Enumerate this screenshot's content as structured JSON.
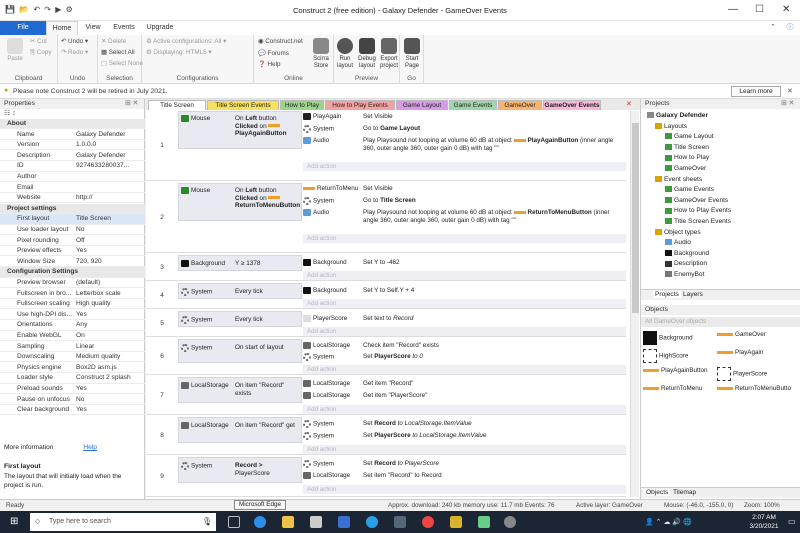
{
  "window": {
    "title": "Construct 2  (free edition) - Galaxy Defender - GameOver Events",
    "minimize": "—",
    "maximize": "☐",
    "close": "✕"
  },
  "menu": {
    "file": "File",
    "home": "Home",
    "view": "View",
    "events": "Events",
    "upgrade": "Upgrade"
  },
  "ribbon": {
    "cut": "Cut",
    "copy": "Copy",
    "paste": "Paste",
    "undo": "Undo",
    "redo": "Redo",
    "delete": "Delete",
    "select_all": "Select All",
    "select_none": "Select None",
    "active_config": "Active configurations: All",
    "displaying": "Displaying: HTML5",
    "construct_net": "Construct.net",
    "forums": "Forums",
    "help": "Help",
    "scirra_store": "Scirra Store",
    "run_layout": "Run layout",
    "debug_layout": "Debug layout",
    "export_project": "Export project",
    "start_page": "Start Page",
    "groups": {
      "clipboard": "Clipboard",
      "undo": "Undo",
      "selection": "Selection",
      "configurations": "Configurations",
      "online": "Online",
      "preview": "Preview",
      "go": "Go"
    }
  },
  "notice": {
    "text": "Please note Construct 2 will be retired in July 2021.",
    "learn_more": "Learn more"
  },
  "properties": {
    "header": "Properties",
    "rows": [
      {
        "k": "About",
        "v": "",
        "sec": true
      },
      {
        "k": "Name",
        "v": "Galaxy Defender"
      },
      {
        "k": "Version",
        "v": "1.0.0.0"
      },
      {
        "k": "Description",
        "v": "Galaxy Defender"
      },
      {
        "k": "ID",
        "v": "9274633280037..."
      },
      {
        "k": "Author",
        "v": ""
      },
      {
        "k": "Email",
        "v": ""
      },
      {
        "k": "Website",
        "v": "http://"
      },
      {
        "k": "Project settings",
        "v": "",
        "sec": true
      },
      {
        "k": "First layout",
        "v": "Title Screen"
      },
      {
        "k": "Use loader layout",
        "v": "No"
      },
      {
        "k": "Pixel rounding",
        "v": "Off"
      },
      {
        "k": "Preview effects",
        "v": "Yes"
      },
      {
        "k": "Window Size",
        "v": "720, 920"
      },
      {
        "k": "Configuration Settings",
        "v": "",
        "sec": true
      },
      {
        "k": "Preview browser",
        "v": "(default)"
      },
      {
        "k": "Fullscreen in bro...",
        "v": "Letterbox scale"
      },
      {
        "k": "Fullscreen scaling",
        "v": "High quality"
      },
      {
        "k": "Use high-DPI dis...",
        "v": "Yes"
      },
      {
        "k": "Orientations",
        "v": "Any"
      },
      {
        "k": "Enable WebGL",
        "v": "On"
      },
      {
        "k": "Sampling",
        "v": "Linear"
      },
      {
        "k": "Downscaling",
        "v": "Medium quality"
      },
      {
        "k": "Physics engine",
        "v": "Box2D asm.js"
      },
      {
        "k": "Loader style",
        "v": "Construct 2 splash"
      },
      {
        "k": "Preload sounds",
        "v": "Yes"
      },
      {
        "k": "Pause on unfocus",
        "v": "No"
      },
      {
        "k": "Clear background",
        "v": "Yes"
      }
    ],
    "more_info": "More information",
    "help_link": "Help",
    "desc_title": "First layout",
    "desc_text": "The layout that will initially load when the project is run."
  },
  "tabs": [
    "Title Screen",
    "Title Screen Events",
    "How to Play",
    "How to Play Events",
    "Game Layout",
    "Game Events",
    "GameOver",
    "GameOver Events"
  ],
  "tab_colors": [
    "#ffffff",
    "#f6e05f",
    "#9bd48b",
    "#f4a1a1",
    "#d59de6",
    "#9fd6a9",
    "#f8b46e",
    "#f6b8d6"
  ],
  "add_action": "Add action",
  "events": {
    "e1": {
      "n": "1",
      "c1": "Mouse",
      "c2a": "On ",
      "c2b": "Left",
      "c2c": " button",
      "c2d": "Clicked",
      "c2e": " on",
      "c2f": "PlayAgainButton",
      "a1o": "PlayAgain",
      "a1t": "Set Visible",
      "a2o": "System",
      "a2t1": "Go to ",
      "a2t2": "Game Layout",
      "a3o": "Audio",
      "a3t": "Play Playsound not looping at volume 60 dB at object",
      "a3t2": "PlayAgainButton",
      "a3t3": " (inner angle 360, outer angle 360, outer gain 0 dB) with tag \"\""
    },
    "e2": {
      "n": "2",
      "c1": "Mouse",
      "c2a": "On ",
      "c2b": "Left",
      "c2c": " button",
      "c2d": "Clicked",
      "c2e": " on",
      "c2f": "ReturnToMenuButton",
      "a1o": "ReturnToMenu",
      "a1t": "Set Visible",
      "a2o": "System",
      "a2t1": "Go to ",
      "a2t2": "Title Screen",
      "a3o": "Audio",
      "a3t": "Play Playsound not looping at volume 60 dB at object",
      "a3t2": "ReturnToMenuButton",
      "a3t3": " (inner angle 360, outer angle 360, outer gain 0 dB) with tag \"\""
    },
    "e3": {
      "n": "3",
      "c1": "Background",
      "c2": "Y ≥ 1378",
      "a1o": "Background",
      "a1t": "Set Y to -462"
    },
    "e4": {
      "n": "4",
      "c1": "System",
      "c2": "Every tick",
      "a1o": "Background",
      "a1t": "Set Y to Self.Y + 4"
    },
    "e5": {
      "n": "5",
      "c1": "System",
      "c2": "Every tick",
      "a1o": "PlayerScore",
      "a1t1": "Set text to ",
      "a1t2": "Record"
    },
    "e6": {
      "n": "6",
      "c1": "System",
      "c2": "On start of layout",
      "a1o": "LocalStorage",
      "a1t": "Check item \"Record\" exists",
      "a2o": "System",
      "a2t1": "Set ",
      "a2t2": "PlayerScore",
      "a2t3": " to 0"
    },
    "e7": {
      "n": "7",
      "c1": "LocalStorage",
      "c2a": "On item \"Record\"",
      "c2b": "exists",
      "a1o": "LocalStorage",
      "a1t": "Get item \"Record\"",
      "a2o": "LocalStorage",
      "a2t": "Get item \"PlayerScore\""
    },
    "e8": {
      "n": "8",
      "c1": "LocalStorage",
      "c2": "On item \"Record\" get",
      "a1o": "System",
      "a1t1": "Set ",
      "a1t2": "Record",
      "a1t3": " to LocalStorage.ItemValue",
      "a2o": "System",
      "a2t1": "Set ",
      "a2t2": "PlayerScore",
      "a2t3": " to LocalStorage.ItemValue"
    },
    "e9": {
      "n": "9",
      "c1": "System",
      "c2a": "Record >",
      "c2b": "PlayerScore",
      "a1o": "System",
      "a1t1": "Set ",
      "a1t2": "Record",
      "a1t3": " to PlayerScore",
      "a2o": "LocalStorage",
      "a2t": "Set item \"Record\" to Record"
    }
  },
  "projects": {
    "header": "Projects",
    "items": [
      "Galaxy Defender",
      "Layouts",
      "Game Layout",
      "Title Screen",
      "How to Play",
      "GameOver",
      "Event sheets",
      "Game Events",
      "GameOver Events",
      "How to Play Events",
      "Title Screen Events",
      "Object types",
      "Audio",
      "Background",
      "Description",
      "EnemyBot"
    ],
    "tab_projects": "Projects",
    "tab_layers": "Layers"
  },
  "objects": {
    "header": "Objects",
    "filter": "All GameOver objects",
    "items": [
      "Background",
      "GameOver",
      "HighScore",
      "PlayAgain",
      "PlayAgainButton",
      "PlayerScore",
      "ReturnToMenu",
      "ReturnToMenuButto"
    ],
    "tab_objects": "Objects",
    "tab_tilemap": "Tilemap"
  },
  "status": {
    "ready": "Ready",
    "download": "Approx. download: 240 kb  memory use: 11.7 mb  Events: 76",
    "layer": "Active layer: GameOver",
    "mouse": "Mouse: (-46.0, -155.0, 0)",
    "zoom": "Zoom: 100%"
  },
  "tooltip": "Microsoft Edge",
  "taskbar": {
    "search": "Type here to search",
    "time": "2:07 AM",
    "date": "3/20/2021"
  }
}
